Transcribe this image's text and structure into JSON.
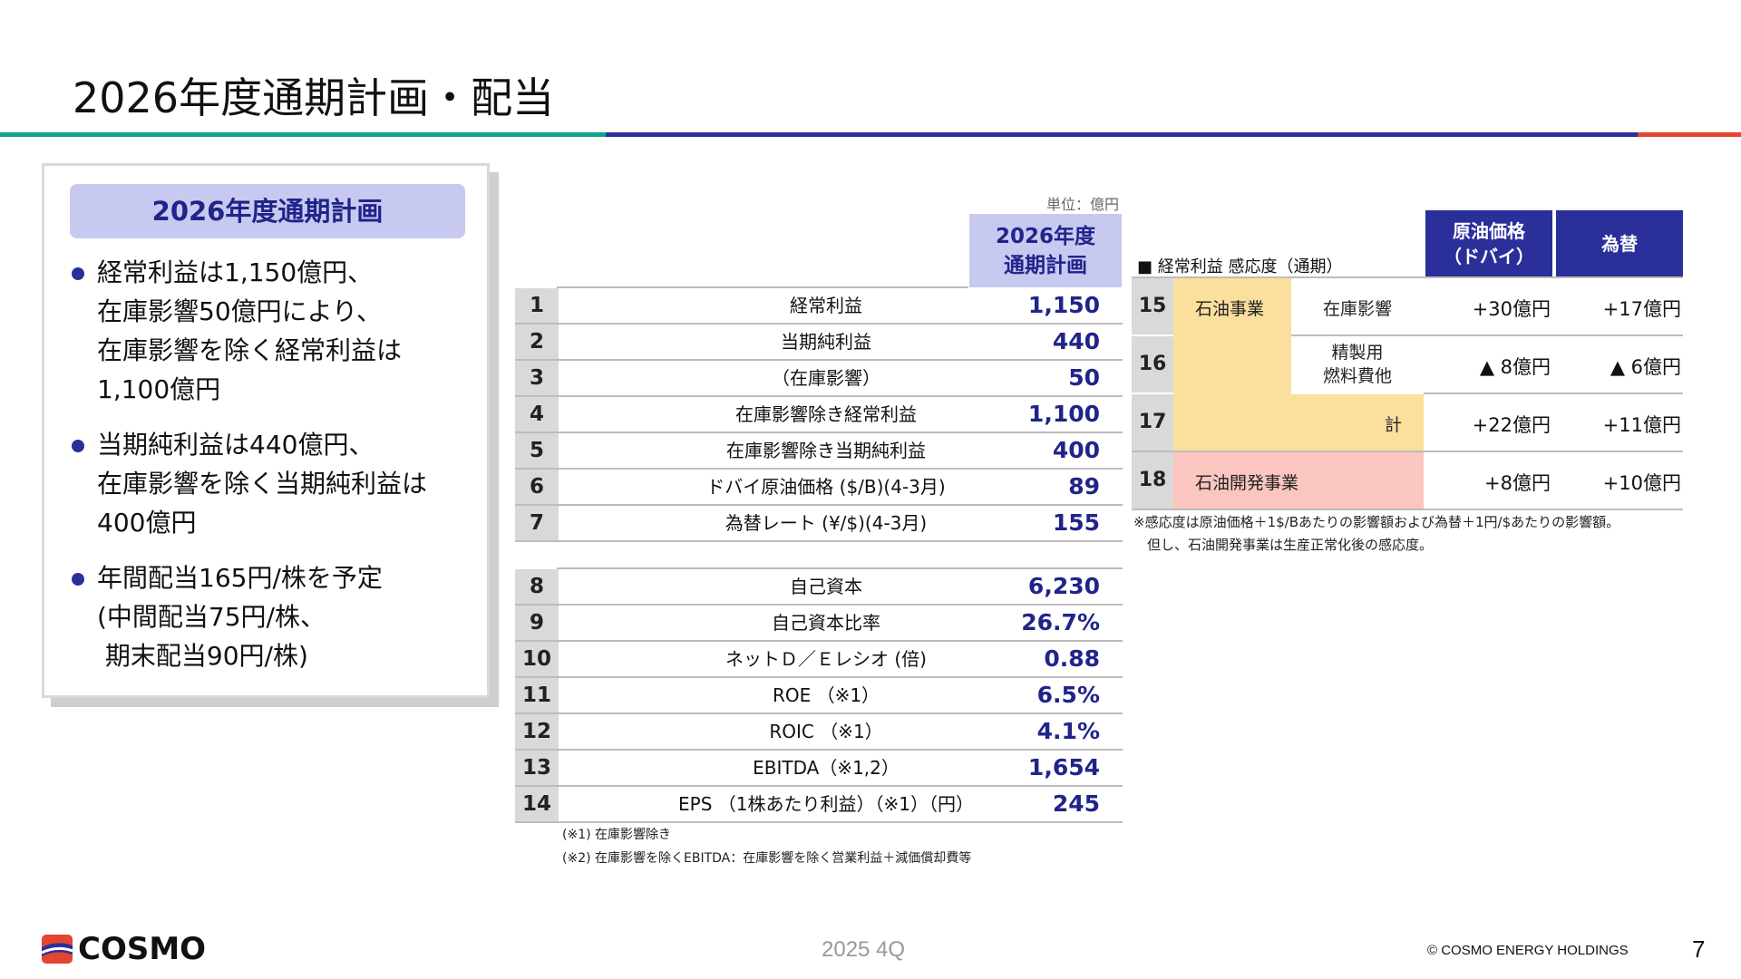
{
  "title": "2026年度通期計画・配当",
  "panel": {
    "heading": "2026年度通期計画",
    "bullets": [
      [
        "経常利益は1,150億円、",
        "在庫影響50億円により、",
        "在庫影響を除く経常利益は",
        "1,100億円"
      ],
      [
        "当期純利益は440億円、",
        "在庫影響を除く当期純利益は",
        "400億円"
      ],
      [
        "年間配当165円/株を予定",
        "(中間配当75円/株、",
        " 期末配当90円/株)"
      ]
    ]
  },
  "main_table": {
    "unit": "単位：億円",
    "column_header": [
      "2026年度",
      "通期計画"
    ],
    "rows": [
      {
        "no": "1",
        "label": "経常利益",
        "value": "1,150"
      },
      {
        "no": "2",
        "label": "当期純利益",
        "value": "440"
      },
      {
        "no": "3",
        "label": "（在庫影響）",
        "value": "50"
      },
      {
        "no": "4",
        "label": "在庫影響除き経常利益",
        "value": "1,100"
      },
      {
        "no": "5",
        "label": "在庫影響除き当期純利益",
        "value": "400"
      },
      {
        "no": "6",
        "label": "ドバイ原油価格 ($/B)(4-3月)",
        "value": "89"
      },
      {
        "no": "7",
        "label": "為替レート (¥/$)(4-3月)",
        "value": "155"
      },
      {
        "no": "8",
        "label": "自己資本",
        "value": "6,230"
      },
      {
        "no": "9",
        "label": "自己資本比率",
        "value": "26.7%"
      },
      {
        "no": "10",
        "label": "ネットＤ／Ｅレシオ (倍)",
        "value": "0.88"
      },
      {
        "no": "11",
        "label": "ROE （※1）",
        "value": "6.5%"
      },
      {
        "no": "12",
        "label": "ROIC （※1）",
        "value": "4.1%"
      },
      {
        "no": "13",
        "label": "EBITDA（※1,2）",
        "value": "1,654"
      },
      {
        "no": "14",
        "label": "EPS （1株あたり利益）（※1）（円）",
        "value": "245"
      }
    ],
    "notes": [
      "(※1) 在庫影響除き",
      "(※2) 在庫影響を除くEBITDA：在庫影響を除く営業利益＋減価償却費等"
    ]
  },
  "sensitivity": {
    "title": "■ 経常利益 感応度（通期）",
    "headers": {
      "crude": [
        "原油価格",
        "（ドバイ）"
      ],
      "fx": "為替"
    },
    "rows": [
      {
        "no": "15",
        "segment": "石油事業",
        "item": "在庫影響",
        "crude": "+30億円",
        "fx": "+17億円"
      },
      {
        "no": "16",
        "segment": "",
        "item": [
          "精製用",
          "燃料費他"
        ],
        "crude": "▲ 8億円",
        "fx": "▲ 6億円"
      },
      {
        "no": "17",
        "segment": "",
        "item": "計",
        "crude": "+22億円",
        "fx": "+11億円"
      },
      {
        "no": "18",
        "segment": "石油開発事業",
        "item": "",
        "crude": "+8億円",
        "fx": "+10億円"
      }
    ],
    "notes": [
      "※感応度は原油価格＋1$/Bあたりの影響額および為替＋1円/$あたりの影響額。",
      "　但し、石油開発事業は生産正常化後の感応度。"
    ]
  },
  "footer": {
    "logo_text": "COSMO",
    "period": "2025 4Q",
    "copyright": "© COSMO ENERGY HOLDINGS",
    "page": "7"
  },
  "colors": {
    "accent_navy": "#2a2f9a",
    "header_lavender": "#c8c9f0",
    "teal": "#0fa48e",
    "red": "#e34530",
    "yellow_cell": "#fadf9d",
    "pink_cell": "#fbc5c0"
  }
}
